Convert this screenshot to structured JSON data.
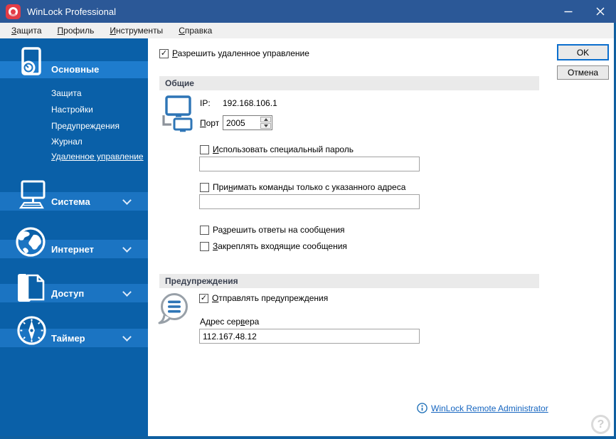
{
  "window": {
    "title": "WinLock Professional"
  },
  "menu": {
    "items": [
      {
        "label": "&Защита"
      },
      {
        "label": "&Профиль"
      },
      {
        "label": "&Инструменты"
      },
      {
        "label": "&Справка"
      }
    ]
  },
  "sidebar": {
    "sections": [
      {
        "label": "Основные"
      },
      {
        "label": "Система"
      },
      {
        "label": "Интернет"
      },
      {
        "label": "Доступ"
      },
      {
        "label": "Таймер"
      }
    ],
    "general_items": [
      {
        "label": "Защита"
      },
      {
        "label": "Настройки"
      },
      {
        "label": "Предупреждения"
      },
      {
        "label": "Журнал"
      },
      {
        "label": "Удаленное управление"
      }
    ]
  },
  "dialog": {
    "ok_label": "OK",
    "cancel_label": "Отмена",
    "remote_checkbox_label": "&Разрешить удаленное управление",
    "general": {
      "title": "Общие",
      "ip_label": "IP:",
      "ip_value": "192.168.106.1",
      "port_label": "&Порт",
      "port_value": "2005",
      "special_password_label": "&Использовать специальный пароль",
      "special_password_value": "",
      "accept_address_label": "При&нимать команды только с указанного адреса",
      "accept_address_value": "",
      "allow_replies_label": "Ра&зрешить ответы на сообщения",
      "pin_messages_label": "&Закреплять входящие сообщения"
    },
    "warnings": {
      "title": "Предупреждения",
      "send_warnings_label": "&Отправлять предупреждения",
      "server_address_label": "Адрес сер&вера",
      "server_address_value": "112.167.48.12"
    },
    "checks": {
      "remote": true,
      "special_password": false,
      "accept_address": false,
      "allow_replies": false,
      "pin_messages": false,
      "send_warnings": true
    }
  },
  "footer": {
    "link_label": "WinLock Remote Administrator",
    "help_glyph": "?"
  },
  "colors": {
    "titlebar": "#2b5897",
    "sidebar": "#0a60a8",
    "sidebar_highlight": "#1e7ccd",
    "group_band": "#eaeaea",
    "accent_blue": "#2e75b6",
    "link": "#1565c0",
    "ok_border": "#0b6ecd",
    "logo_red": "#e23c47"
  }
}
